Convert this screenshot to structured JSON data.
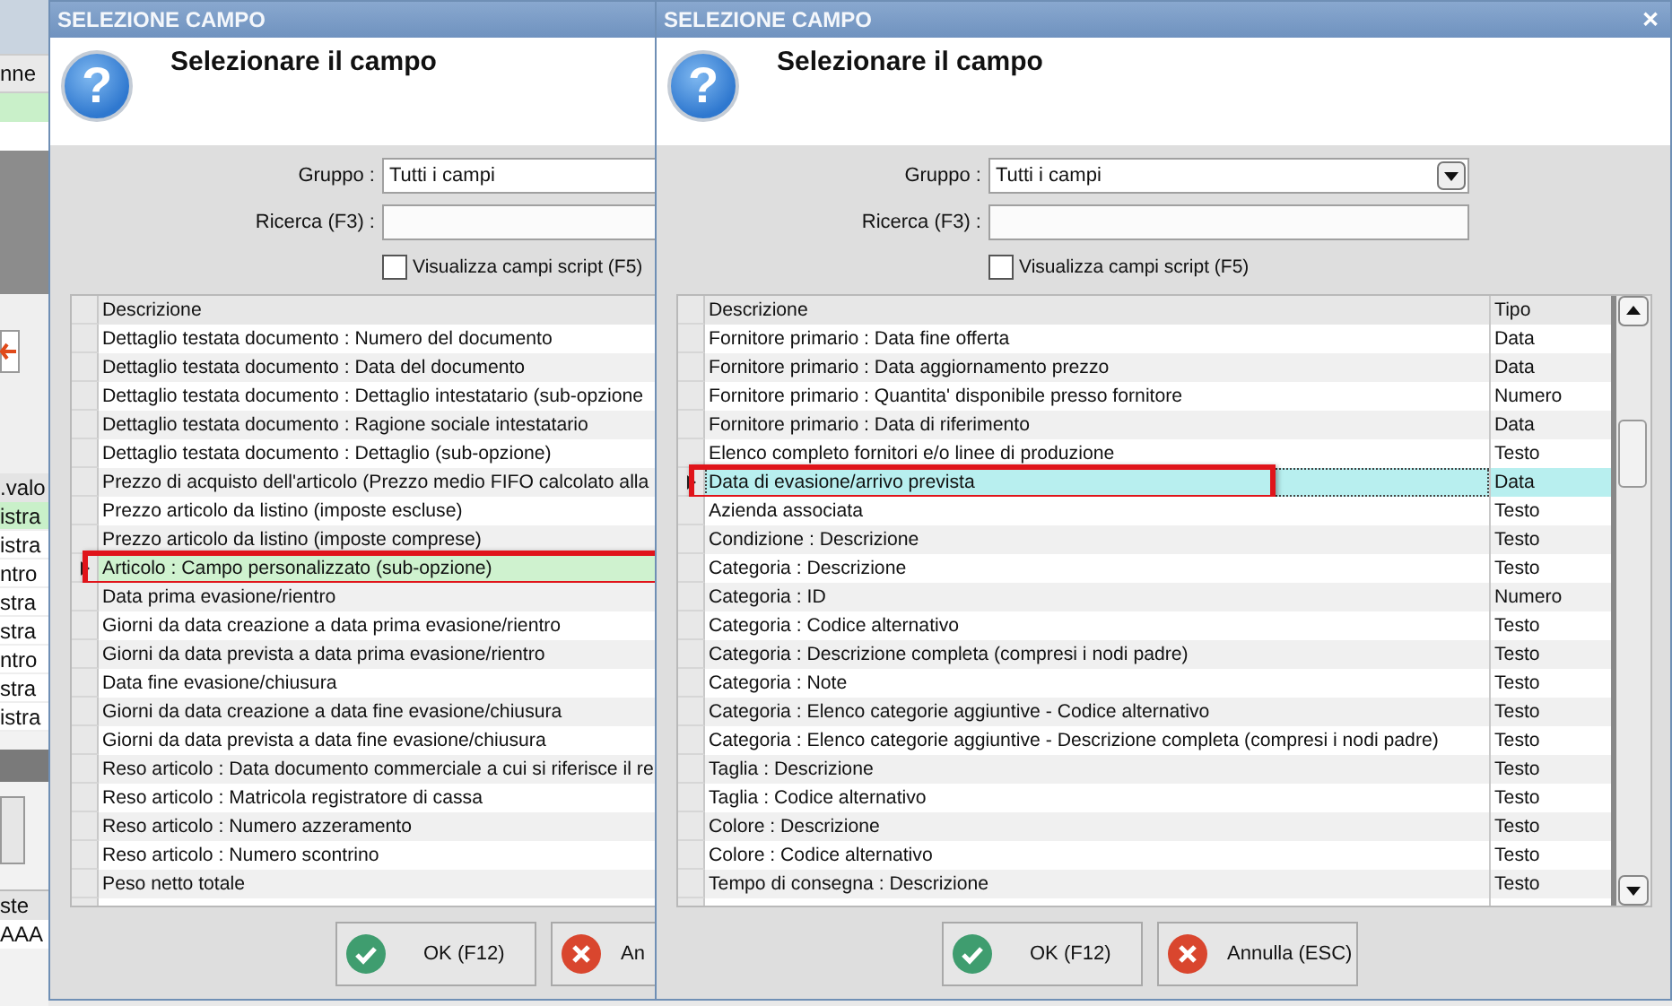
{
  "background_window": {
    "top_grid": {
      "header": "nne",
      "rows": [
        {
          "selected": true
        },
        {
          "selected": false
        }
      ]
    },
    "middle_grid": {
      "header": ".valo",
      "rows": [
        {
          "text": "istra",
          "selected": true
        },
        {
          "text": "istra",
          "selected": false
        },
        {
          "text": "ntro",
          "selected": false
        },
        {
          "text": "stra",
          "selected": false
        },
        {
          "text": "stra",
          "selected": false
        },
        {
          "text": "ntro",
          "selected": false
        },
        {
          "text": "stra",
          "selected": false
        },
        {
          "text": "istra",
          "selected": false
        }
      ]
    },
    "bottom_grid": {
      "header": "ste",
      "rows": [
        "AAA"
      ]
    }
  },
  "dialogs": [
    {
      "title": "SELEZIONE CAMPO",
      "icon_glyph": "?",
      "heading": "Selezionare il campo",
      "group_label": "Gruppo :",
      "group_value": "Tutti i campi",
      "search_label": "Ricerca (F3) :",
      "script_fields": {
        "label": "Visualizza campi script (F5)",
        "checked": false
      },
      "columns": [
        "Descrizione"
      ],
      "rows": [
        {
          "cells": [
            "Dettaglio testata documento : Numero del documento"
          ],
          "selected": false,
          "highlighted": false
        },
        {
          "cells": [
            "Dettaglio testata documento : Data del documento"
          ],
          "selected": false,
          "highlighted": false
        },
        {
          "cells": [
            "Dettaglio testata documento : Dettaglio intestatario (sub-opzione"
          ],
          "selected": false,
          "highlighted": false
        },
        {
          "cells": [
            "Dettaglio testata documento : Ragione sociale intestatario"
          ],
          "selected": false,
          "highlighted": false
        },
        {
          "cells": [
            "Dettaglio testata documento : Dettaglio (sub-opzione)"
          ],
          "selected": false,
          "highlighted": false
        },
        {
          "cells": [
            "Prezzo di acquisto dell'articolo (Prezzo medio FIFO calcolato alla"
          ],
          "selected": false,
          "highlighted": false
        },
        {
          "cells": [
            "Prezzo articolo da listino (imposte escluse)"
          ],
          "selected": false,
          "highlighted": false
        },
        {
          "cells": [
            "Prezzo articolo da listino (imposte comprese)"
          ],
          "selected": false,
          "highlighted": false
        },
        {
          "cells": [
            "Articolo : Campo personalizzato (sub-opzione)"
          ],
          "selected": true,
          "highlighted": true
        },
        {
          "cells": [
            "Data prima evasione/rientro"
          ],
          "selected": false,
          "highlighted": false
        },
        {
          "cells": [
            "Giorni da data creazione a data prima evasione/rientro"
          ],
          "selected": false,
          "highlighted": false
        },
        {
          "cells": [
            "Giorni da data prevista a data prima evasione/rientro"
          ],
          "selected": false,
          "highlighted": false
        },
        {
          "cells": [
            "Data fine evasione/chiusura"
          ],
          "selected": false,
          "highlighted": false
        },
        {
          "cells": [
            "Giorni da data creazione a data fine evasione/chiusura"
          ],
          "selected": false,
          "highlighted": false
        },
        {
          "cells": [
            "Giorni da data prevista a data fine evasione/chiusura"
          ],
          "selected": false,
          "highlighted": false
        },
        {
          "cells": [
            "Reso articolo : Data documento commerciale a cui si riferisce il re"
          ],
          "selected": false,
          "highlighted": false
        },
        {
          "cells": [
            "Reso articolo : Matricola registratore di cassa"
          ],
          "selected": false,
          "highlighted": false
        },
        {
          "cells": [
            "Reso articolo : Numero azzeramento"
          ],
          "selected": false,
          "highlighted": false
        },
        {
          "cells": [
            "Reso articolo : Numero scontrino"
          ],
          "selected": false,
          "highlighted": false
        },
        {
          "cells": [
            "Peso netto totale"
          ],
          "selected": false,
          "highlighted": false
        }
      ],
      "buttons": [
        {
          "kind": "ok",
          "label": "OK (F12)"
        },
        {
          "kind": "cancel",
          "label": "An"
        }
      ]
    },
    {
      "title": "SELEZIONE CAMPO",
      "close_glyph": "✕",
      "icon_glyph": "?",
      "heading": "Selezionare il campo",
      "group_label": "Gruppo :",
      "group_value": "Tutti i campi",
      "group_arrow": true,
      "search_label": "Ricerca (F3) :",
      "script_fields": {
        "label": "Visualizza campi script (F5)",
        "checked": false
      },
      "columns": [
        "Descrizione",
        "Tipo"
      ],
      "rows": [
        {
          "cells": [
            "Fornitore primario : Data fine offerta",
            "Data"
          ],
          "selected": false,
          "highlighted": false
        },
        {
          "cells": [
            "Fornitore primario : Data aggiornamento prezzo",
            "Data"
          ],
          "selected": false,
          "highlighted": false
        },
        {
          "cells": [
            "Fornitore primario : Quantita' disponibile presso fornitore",
            "Numero"
          ],
          "selected": false,
          "highlighted": false
        },
        {
          "cells": [
            "Fornitore primario : Data di riferimento",
            "Data"
          ],
          "selected": false,
          "highlighted": false
        },
        {
          "cells": [
            "Elenco completo fornitori e/o linee di produzione",
            "Testo"
          ],
          "selected": false,
          "highlighted": false
        },
        {
          "cells": [
            "Data di evasione/arrivo prevista",
            "Data"
          ],
          "selected": true,
          "highlighted": true
        },
        {
          "cells": [
            "Azienda associata",
            "Testo"
          ],
          "selected": false,
          "highlighted": false
        },
        {
          "cells": [
            "Condizione : Descrizione",
            "Testo"
          ],
          "selected": false,
          "highlighted": false
        },
        {
          "cells": [
            "Categoria : Descrizione",
            "Testo"
          ],
          "selected": false,
          "highlighted": false
        },
        {
          "cells": [
            "Categoria : ID",
            "Numero"
          ],
          "selected": false,
          "highlighted": false
        },
        {
          "cells": [
            "Categoria : Codice alternativo",
            "Testo"
          ],
          "selected": false,
          "highlighted": false
        },
        {
          "cells": [
            "Categoria : Descrizione completa (compresi i nodi padre)",
            "Testo"
          ],
          "selected": false,
          "highlighted": false
        },
        {
          "cells": [
            "Categoria : Note",
            "Testo"
          ],
          "selected": false,
          "highlighted": false
        },
        {
          "cells": [
            "Categoria : Elenco categorie aggiuntive - Codice alternativo",
            "Testo"
          ],
          "selected": false,
          "highlighted": false
        },
        {
          "cells": [
            "Categoria : Elenco categorie aggiuntive - Descrizione completa (compresi i nodi padre)",
            "Testo"
          ],
          "selected": false,
          "highlighted": false
        },
        {
          "cells": [
            "Taglia : Descrizione",
            "Testo"
          ],
          "selected": false,
          "highlighted": false
        },
        {
          "cells": [
            "Taglia : Codice alternativo",
            "Testo"
          ],
          "selected": false,
          "highlighted": false
        },
        {
          "cells": [
            "Colore : Descrizione",
            "Testo"
          ],
          "selected": false,
          "highlighted": false
        },
        {
          "cells": [
            "Colore : Codice alternativo",
            "Testo"
          ],
          "selected": false,
          "highlighted": false
        },
        {
          "cells": [
            "Tempo di consegna : Descrizione",
            "Testo"
          ],
          "selected": false,
          "highlighted": false
        }
      ],
      "buttons": [
        {
          "kind": "ok",
          "label": "OK (F12)"
        },
        {
          "kind": "cancel",
          "label": "Annulla (ESC)"
        }
      ]
    }
  ]
}
